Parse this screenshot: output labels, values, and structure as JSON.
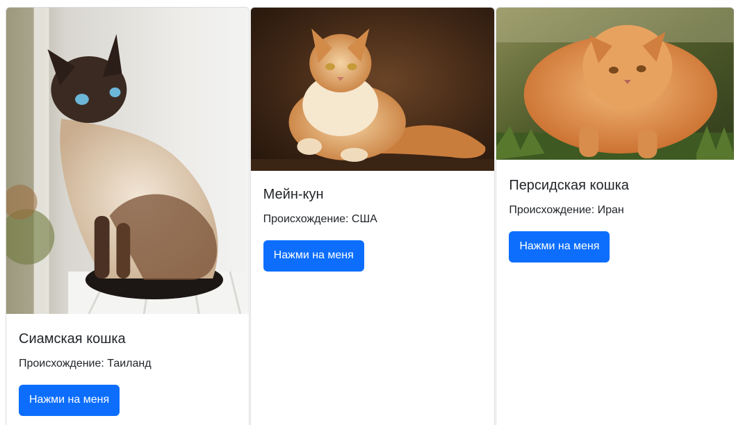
{
  "cards": [
    {
      "title": "Сиамская кошка",
      "text": "Происхождение: Таиланд",
      "button_label": "Нажми на меня",
      "image_alt": "siamese-cat-photo"
    },
    {
      "title": "Мейн-кун",
      "text": "Происхождение: США",
      "button_label": "Нажми на меня",
      "image_alt": "maine-coon-cat-photo"
    },
    {
      "title": "Персидская кошка",
      "text": "Происхождение: Иран",
      "button_label": "Нажми на меня",
      "image_alt": "persian-cat-photo"
    }
  ],
  "colors": {
    "button_bg": "#0d6efd",
    "button_text": "#ffffff",
    "text": "#212529",
    "border": "#dcdcdc"
  }
}
